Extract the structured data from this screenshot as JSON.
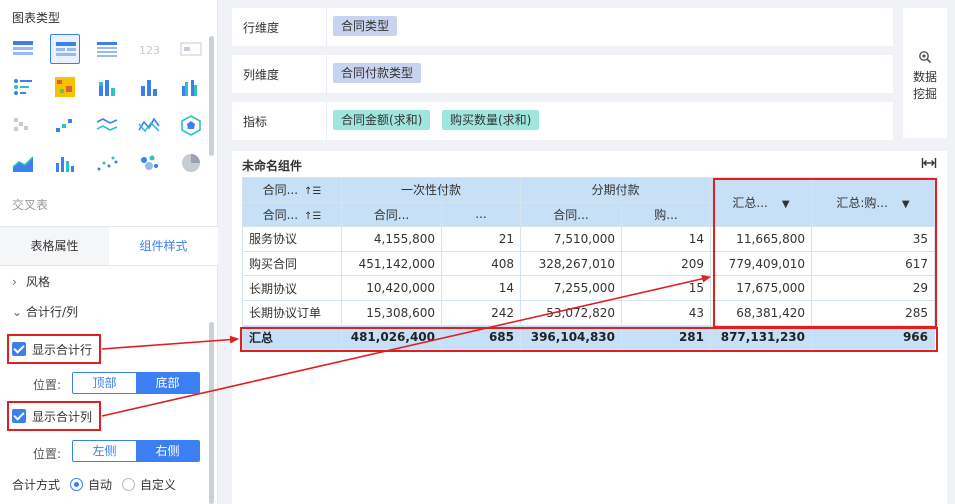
{
  "left_panel": {
    "title": "图表类型",
    "cross_label": "交叉表",
    "tabs": {
      "table_props": "表格属性",
      "component_style": "组件样式"
    },
    "sections": {
      "style": "风格",
      "total_rowcol": "合计行/列"
    },
    "show_total_row": "显示合计行",
    "show_total_col": "显示合计列",
    "position_label": "位置:",
    "row_positions": {
      "top": "顶部",
      "bottom": "底部"
    },
    "col_positions": {
      "left": "左侧",
      "right": "右侧"
    },
    "total_method_label": "合计方式",
    "total_methods": {
      "auto": "自动",
      "custom": "自定义"
    },
    "chart_icons": [
      "cross-table-icon",
      "group-table-icon",
      "detail-table-icon",
      "kpi-number-icon",
      "kpi-card-icon",
      "scatter-list-icon",
      "heatmap-icon",
      "stacked-bar-icon",
      "bar-chart-icon",
      "grouped-bar-icon",
      "waterfall-icon",
      "line-scatter-icon",
      "multi-line-icon",
      "radar-line-icon",
      "polygon-icon",
      "area-chart-icon",
      "combo-bar-icon",
      "dot-chart-icon",
      "bubble-icon",
      "pie-chart-icon"
    ]
  },
  "config": {
    "row_dim_label": "行维度",
    "row_dim_chip": "合同类型",
    "col_dim_label": "列维度",
    "col_dim_chip": "合同付款类型",
    "metric_label": "指标",
    "metric_chips": [
      "合同金额(求和)",
      "购买数量(求和)"
    ],
    "mining_line1": "数据",
    "mining_line2": "挖掘"
  },
  "component": {
    "title": "未命名组件"
  },
  "table": {
    "corner_top": "合同...",
    "corner_bottom": "合同...",
    "col_group_1": "一次性付款",
    "col_group_2": "分期付款",
    "sub_amount": "合同...",
    "sub_qty": "...",
    "sub_amount_2": "合同...",
    "sub_qty_2": "购...",
    "total_amount_header": "汇总...",
    "total_qty_header": "汇总:购...",
    "rows": [
      {
        "name": "服务协议",
        "c1": "4,155,800",
        "c2": "21",
        "c3": "7,510,000",
        "c4": "14",
        "t1": "11,665,800",
        "t2": "35"
      },
      {
        "name": "购买合同",
        "c1": "451,142,000",
        "c2": "408",
        "c3": "328,267,010",
        "c4": "209",
        "t1": "779,409,010",
        "t2": "617"
      },
      {
        "name": "长期协议",
        "c1": "10,420,000",
        "c2": "14",
        "c3": "7,255,000",
        "c4": "15",
        "t1": "17,675,000",
        "t2": "29"
      },
      {
        "name": "长期协议订单",
        "c1": "15,308,600",
        "c2": "242",
        "c3": "53,072,820",
        "c4": "43",
        "t1": "68,381,420",
        "t2": "285"
      }
    ],
    "total": {
      "name": "汇总",
      "c1": "481,026,400",
      "c2": "685",
      "c3": "396,104,830",
      "c4": "281",
      "t1": "877,131,230",
      "t2": "966"
    }
  },
  "colors": {
    "accent": "#3b7ff2",
    "header": "#c5e0f7",
    "annotation": "#e02020"
  }
}
